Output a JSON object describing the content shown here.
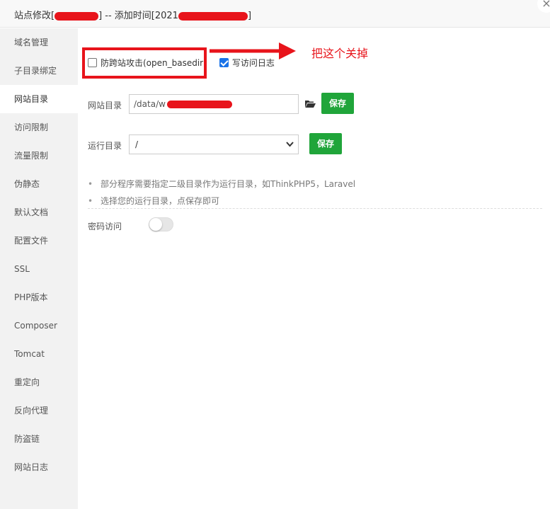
{
  "window": {
    "title_prefix": "站点修改[",
    "title_middle": "] -- 添加时间[2021",
    "title_suffix": "]",
    "close_icon": "×"
  },
  "sidebar": {
    "items": [
      {
        "label": "域名管理"
      },
      {
        "label": "子目录绑定"
      },
      {
        "label": "网站目录",
        "active": true
      },
      {
        "label": "访问限制"
      },
      {
        "label": "流量限制"
      },
      {
        "label": "伪静态"
      },
      {
        "label": "默认文档"
      },
      {
        "label": "配置文件"
      },
      {
        "label": "SSL"
      },
      {
        "label": "PHP版本"
      },
      {
        "label": "Composer"
      },
      {
        "label": "Tomcat"
      },
      {
        "label": "重定向"
      },
      {
        "label": "反向代理"
      },
      {
        "label": "防盗链"
      },
      {
        "label": "网站日志"
      }
    ]
  },
  "options": {
    "open_basedir_label": "防跨站攻击(open_basedir)",
    "open_basedir_checked": false,
    "access_log_label": "写访问日志",
    "access_log_checked": true
  },
  "annotation": {
    "text": "把这个关掉",
    "color": "#e8141b"
  },
  "site_dir": {
    "label": "网站目录",
    "value": "/data/w",
    "save_label": "保存"
  },
  "run_dir": {
    "label": "运行目录",
    "value": "/",
    "save_label": "保存"
  },
  "tips": [
    "部分程序需要指定二级目录作为运行目录，如ThinkPHP5，Laravel",
    "选择您的运行目录，点保存即可"
  ],
  "password_access": {
    "label": "密码访问",
    "enabled": false
  },
  "colors": {
    "accent_green": "#20a53a",
    "highlight_red": "#e8141b",
    "checkbox_blue": "#1a73e8"
  }
}
